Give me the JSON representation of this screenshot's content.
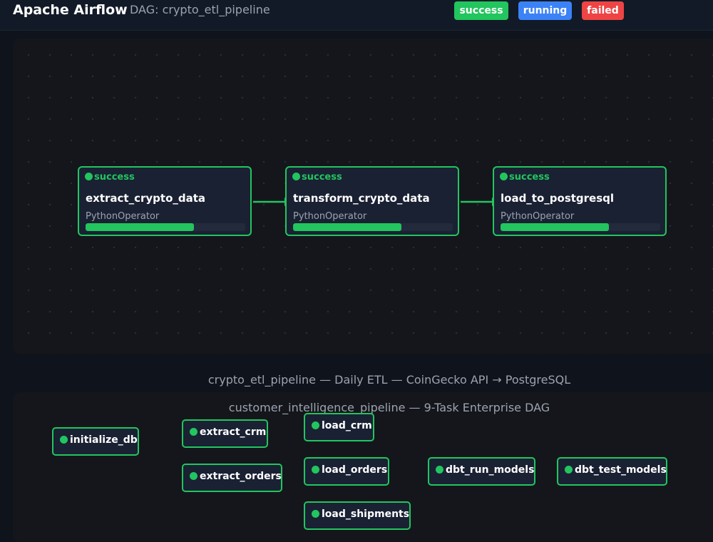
{
  "header": {
    "app_title": "Apache Airflow",
    "dag_title": "DAG: crypto_etl_pipeline",
    "legend": {
      "success": "success",
      "running": "running",
      "failed": "failed"
    }
  },
  "colors": {
    "success": "#22c55e",
    "running": "#3b82f6",
    "failed": "#ef4444",
    "node_bg": "#1a2133",
    "canvas_bg": "#14161b"
  },
  "pipeline": {
    "tasks": [
      {
        "status": "success",
        "name": "extract_crypto_data",
        "operator": "PythonOperator",
        "progress": 0.68
      },
      {
        "status": "success",
        "name": "transform_crypto_data",
        "operator": "PythonOperator",
        "progress": 0.68
      },
      {
        "status": "success",
        "name": "load_to_postgresql",
        "operator": "PythonOperator",
        "progress": 0.68
      }
    ],
    "caption": "crypto_etl_pipeline  —  Daily ETL  —  CoinGecko API → PostgreSQL"
  },
  "customer_dag": {
    "title": "customer_intelligence_pipeline  —  9-Task Enterprise DAG",
    "nodes": {
      "initialize_db": "initialize_db",
      "extract_crm": "extract_crm",
      "extract_orders": "extract_orders",
      "load_crm": "load_crm",
      "load_orders": "load_orders",
      "load_shipments": "load_shipments",
      "dbt_run_models": "dbt_run_models",
      "dbt_test_models": "dbt_test_models"
    }
  }
}
